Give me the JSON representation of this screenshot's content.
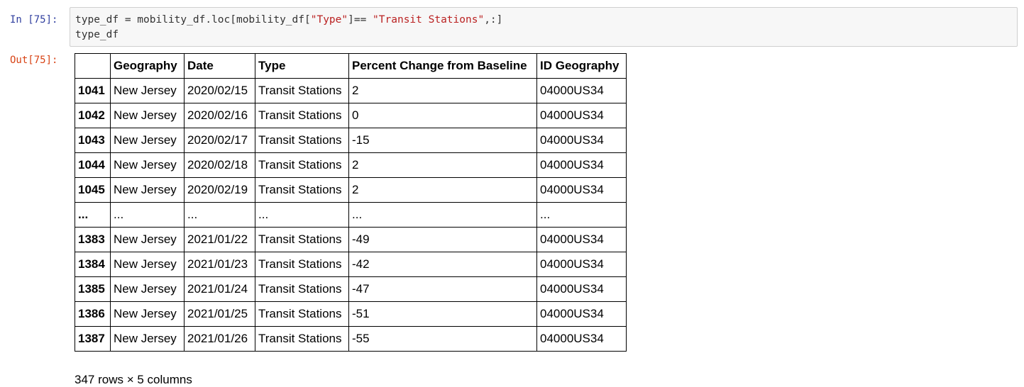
{
  "input_cell": {
    "prompt": "In [75]:",
    "code_line1": {
      "pre": "type_df = mobility_df.loc[mobility_df[",
      "str1": "\"Type\"",
      "mid": "]== ",
      "str2": "\"Transit Stations\"",
      "post": ",:]"
    },
    "code_line2": "type_df"
  },
  "output_cell": {
    "prompt": "Out[75]:",
    "columns": [
      "",
      "Geography",
      "Date",
      "Type",
      "Percent Change from Baseline",
      "ID Geography"
    ],
    "rows": [
      [
        "1041",
        "New Jersey",
        "2020/02/15",
        "Transit Stations",
        "2",
        "04000US34"
      ],
      [
        "1042",
        "New Jersey",
        "2020/02/16",
        "Transit Stations",
        "0",
        "04000US34"
      ],
      [
        "1043",
        "New Jersey",
        "2020/02/17",
        "Transit Stations",
        "-15",
        "04000US34"
      ],
      [
        "1044",
        "New Jersey",
        "2020/02/18",
        "Transit Stations",
        "2",
        "04000US34"
      ],
      [
        "1045",
        "New Jersey",
        "2020/02/19",
        "Transit Stations",
        "2",
        "04000US34"
      ],
      [
        "...",
        "...",
        "...",
        "...",
        "...",
        "..."
      ],
      [
        "1383",
        "New Jersey",
        "2021/01/22",
        "Transit Stations",
        "-49",
        "04000US34"
      ],
      [
        "1384",
        "New Jersey",
        "2021/01/23",
        "Transit Stations",
        "-42",
        "04000US34"
      ],
      [
        "1385",
        "New Jersey",
        "2021/01/24",
        "Transit Stations",
        "-47",
        "04000US34"
      ],
      [
        "1386",
        "New Jersey",
        "2021/01/25",
        "Transit Stations",
        "-51",
        "04000US34"
      ],
      [
        "1387",
        "New Jersey",
        "2021/01/26",
        "Transit Stations",
        "-55",
        "04000US34"
      ]
    ],
    "shape_text": "347 rows × 5 columns"
  }
}
